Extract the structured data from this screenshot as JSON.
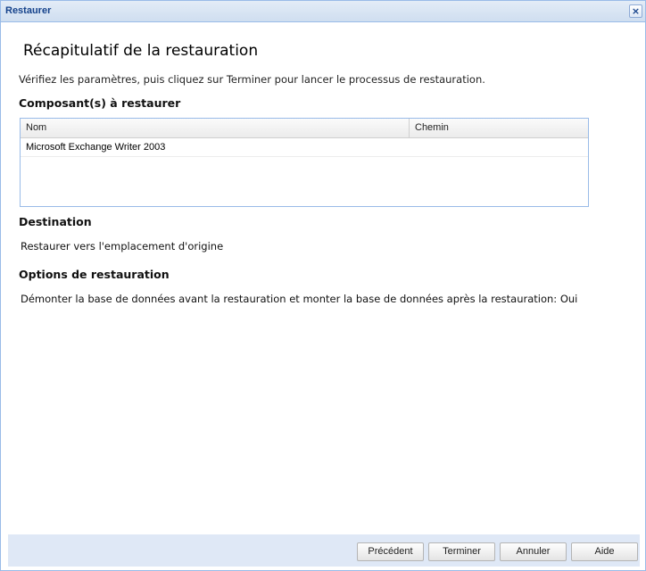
{
  "window": {
    "title": "Restaurer",
    "close_glyph": "×"
  },
  "summary": {
    "heading": "Récapitulatif de la restauration",
    "intro": "Vérifiez les paramètres, puis cliquez sur Terminer pour lancer le processus de restauration."
  },
  "components": {
    "title": "Composant(s) à restaurer",
    "columns": [
      "Nom",
      "Chemin"
    ],
    "rows": [
      [
        "Microsoft Exchange Writer 2003",
        ""
      ]
    ]
  },
  "destination": {
    "title": "Destination",
    "value": "Restaurer vers l'emplacement d'origine"
  },
  "options": {
    "title": "Options de restauration",
    "value": "Démonter la base de données avant la restauration et monter la base de données après la restauration: Oui"
  },
  "buttons": {
    "previous": "Précédent",
    "finish": "Terminer",
    "cancel": "Annuler",
    "help": "Aide"
  }
}
